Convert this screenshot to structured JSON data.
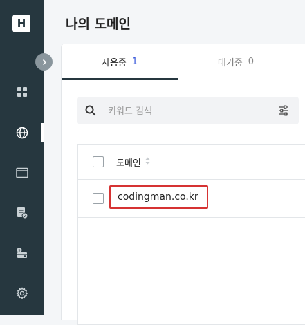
{
  "app": {
    "logo_letter": "H",
    "page_title": "나의 도메인"
  },
  "sidebar": {
    "items": [
      {
        "icon": "dashboard-icon"
      },
      {
        "icon": "globe-icon",
        "active": true
      },
      {
        "icon": "browser-window-icon"
      },
      {
        "icon": "document-check-icon"
      },
      {
        "icon": "billing-card-icon"
      },
      {
        "icon": "gear-icon"
      }
    ],
    "collapse_icon": "chevron-right-icon"
  },
  "tabs": [
    {
      "label": "사용중",
      "count": "1",
      "active": true
    },
    {
      "label": "대기중",
      "count": "0",
      "active": false
    }
  ],
  "search": {
    "placeholder": "키워드 검색",
    "value": ""
  },
  "table": {
    "columns": [
      {
        "label": "도메인",
        "sortable": true
      }
    ],
    "rows": [
      {
        "domain": "codingman.co.kr",
        "highlighted": true
      }
    ]
  },
  "colors": {
    "sidebar_bg": "#26373f",
    "accent": "#3b5bdb",
    "highlight_border": "#d63333"
  }
}
